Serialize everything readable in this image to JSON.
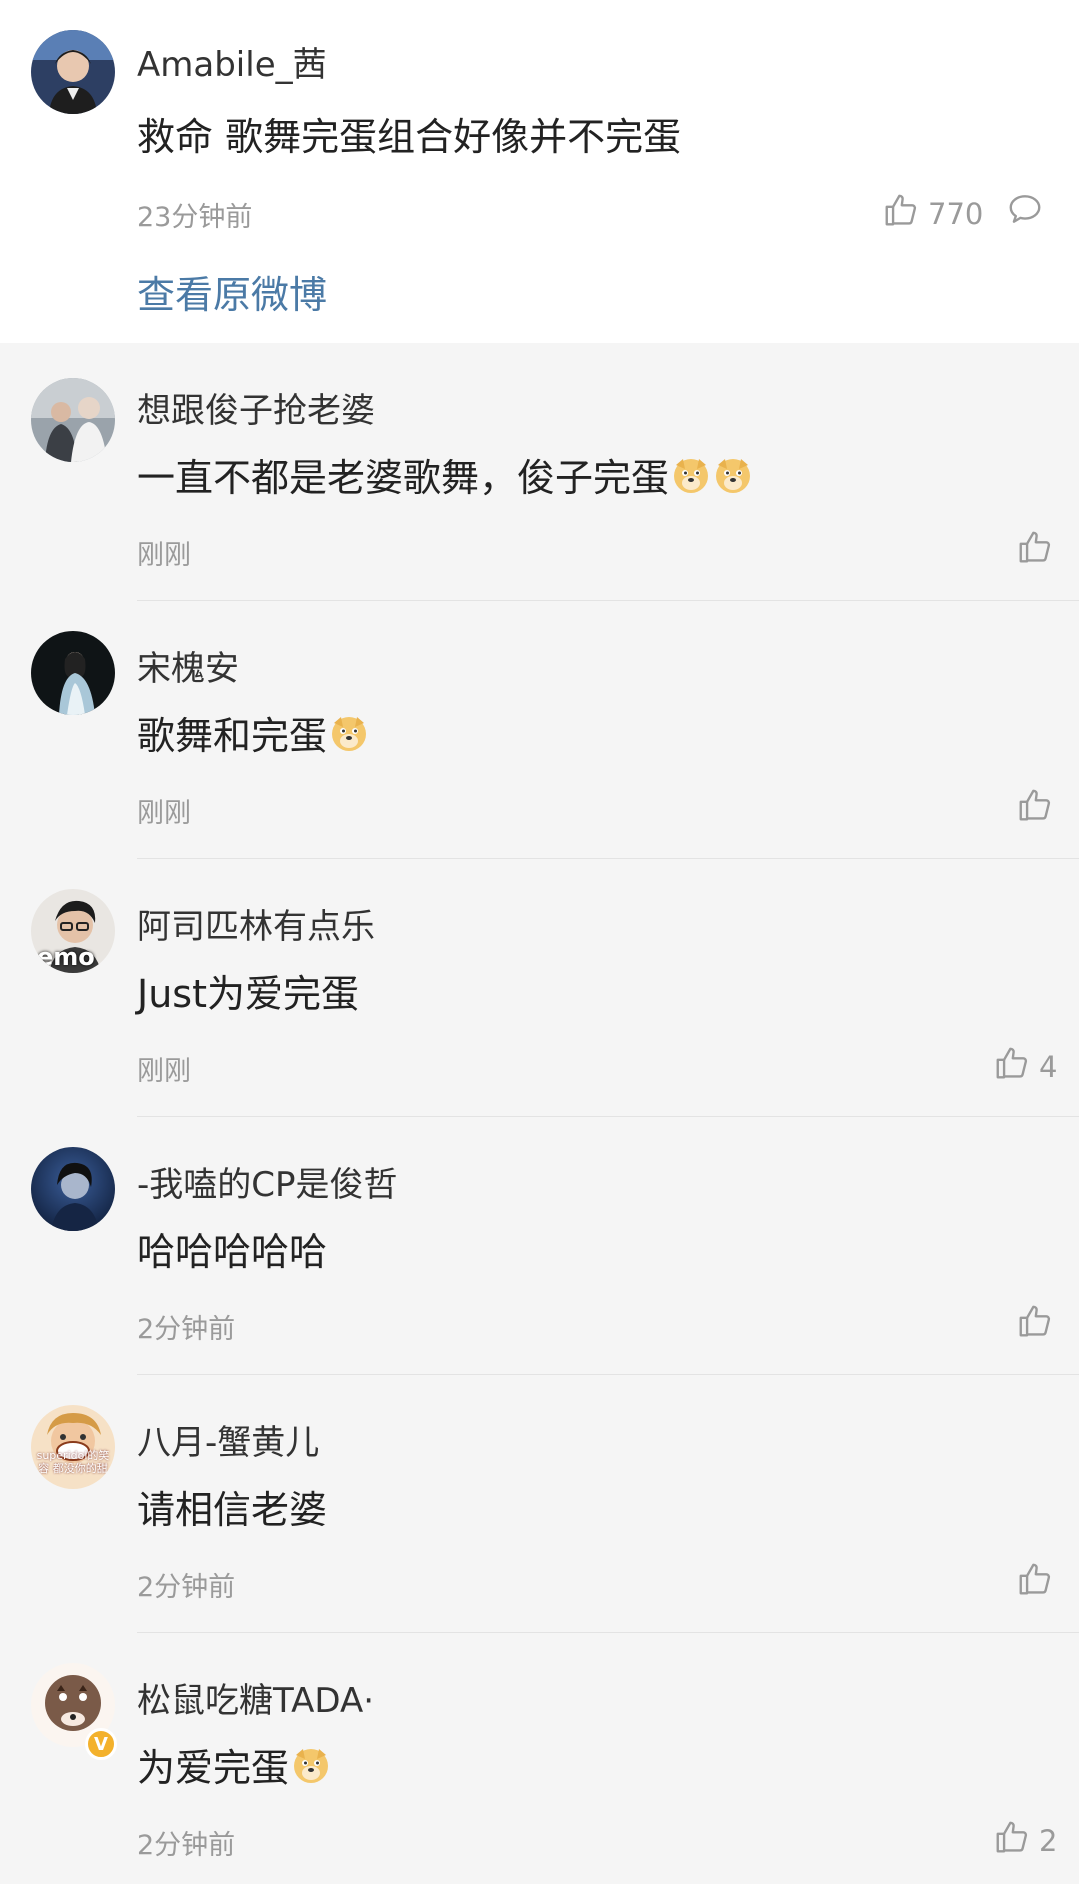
{
  "main_comment": {
    "username": "Amabile_茜",
    "text": "救命 歌舞完蛋组合好像并不完蛋",
    "time": "23分钟前",
    "like_count": "770",
    "view_original": "查看原微博"
  },
  "replies": [
    {
      "username": "想跟俊子抢老婆",
      "text": "一直不都是老婆歌舞，俊子完蛋",
      "emojis": 2,
      "time": "刚刚",
      "like_count": ""
    },
    {
      "username": "宋槐安",
      "text": "歌舞和完蛋",
      "emojis": 1,
      "time": "刚刚",
      "like_count": ""
    },
    {
      "username": "阿司匹林有点乐",
      "text": "Just为爱完蛋",
      "emojis": 0,
      "time": "刚刚",
      "like_count": "4",
      "avatar_text": "emo"
    },
    {
      "username": "-我嗑的CP是俊哲",
      "text": "哈哈哈哈哈",
      "emojis": 0,
      "time": "2分钟前",
      "like_count": ""
    },
    {
      "username": "八月-蟹黄儿",
      "text": "请相信老婆",
      "emojis": 0,
      "time": "2分钟前",
      "like_count": "",
      "avatar_text": "superidol的笑容 都没你的甜"
    },
    {
      "username": "松鼠吃糖TADA·",
      "text": "为爱完蛋",
      "emojis": 1,
      "time": "2分钟前",
      "like_count": "2",
      "verified_badge": "V"
    }
  ],
  "icons": {
    "like": "thumbs-up-icon",
    "reply": "comment-bubble-icon",
    "emoji": "doge-emoji"
  },
  "colors": {
    "link": "#4b7aa6",
    "meta": "#9a9a9a",
    "background": "#f5f5f5"
  }
}
